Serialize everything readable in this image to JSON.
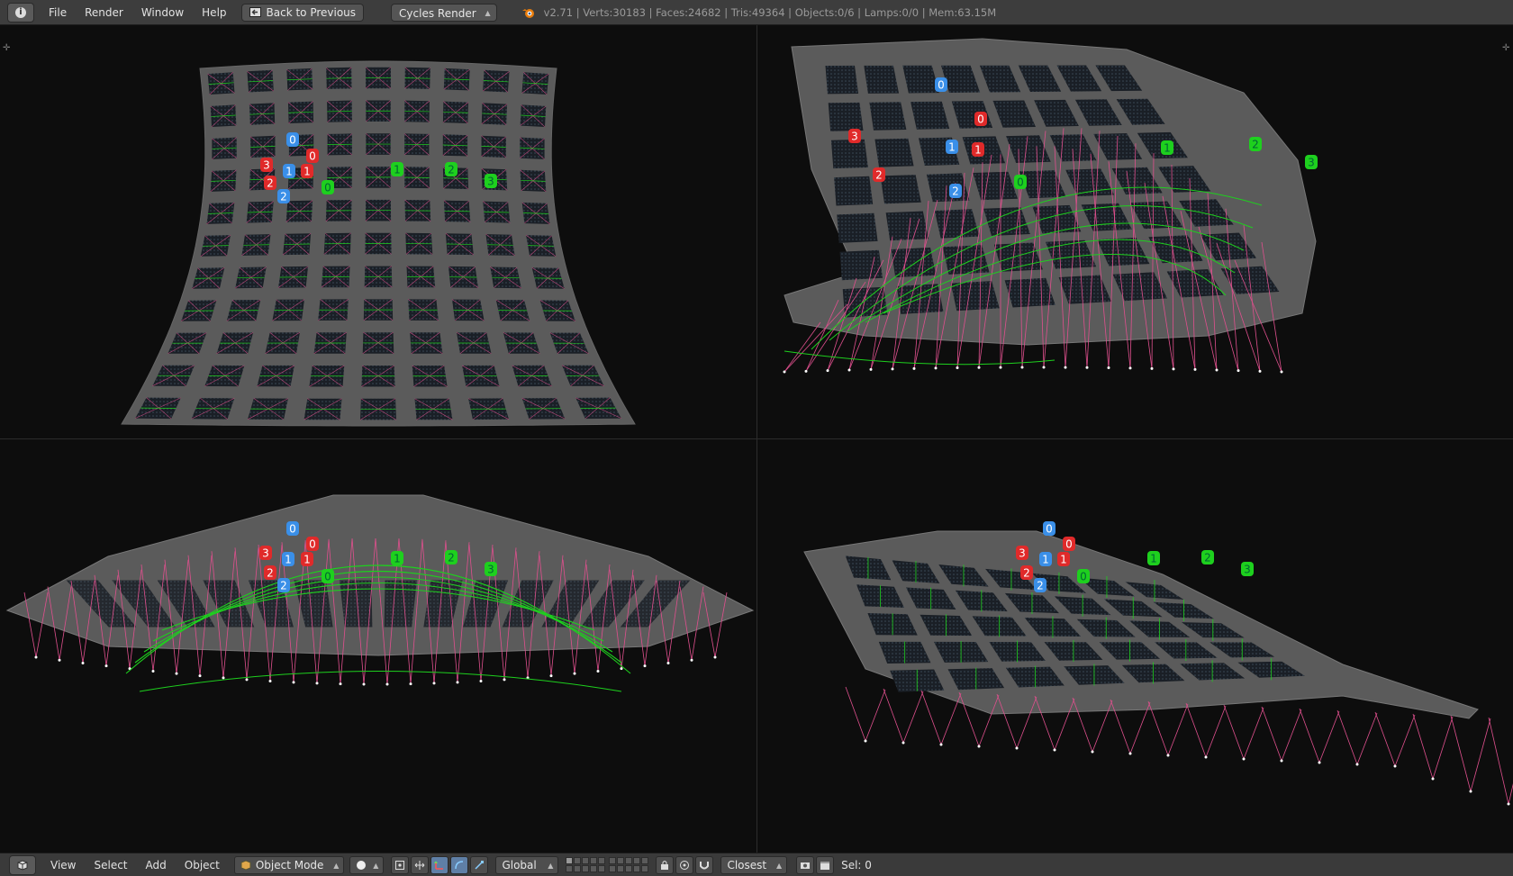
{
  "topbar": {
    "menus": [
      "File",
      "Render",
      "Window",
      "Help"
    ],
    "back_button": "Back to Previous",
    "render_engine": "Cycles Render",
    "stats": "v2.71 | Verts:30183 | Faces:24682 | Tris:49364 | Objects:0/6 | Lamps:0/0 | Mem:63.15M"
  },
  "bottombar": {
    "menus": [
      "View",
      "Select",
      "Add",
      "Object"
    ],
    "mode": "Object Mode",
    "orientation": "Global",
    "snap": "Closest",
    "selection": "Sel: 0"
  },
  "colors": {
    "blue": "#3a8fe8",
    "red": "#e02a2a",
    "green": "#1ed01e",
    "pink": "#e0508e",
    "mesh": "#5b5b5b"
  },
  "viewports": [
    {
      "id": "top",
      "labels": [
        {
          "t": "0",
          "c": "blue"
        },
        {
          "t": "1",
          "c": "blue"
        },
        {
          "t": "2",
          "c": "blue"
        },
        {
          "t": "3",
          "c": "red"
        },
        {
          "t": "0",
          "c": "red"
        },
        {
          "t": "1",
          "c": "red"
        },
        {
          "t": "2",
          "c": "red"
        },
        {
          "t": "0",
          "c": "green"
        },
        {
          "t": "1",
          "c": "green"
        },
        {
          "t": "2",
          "c": "green"
        },
        {
          "t": "3",
          "c": "green"
        }
      ]
    },
    {
      "id": "perspective",
      "labels": [
        {
          "t": "0",
          "c": "blue"
        },
        {
          "t": "1",
          "c": "blue"
        },
        {
          "t": "2",
          "c": "blue"
        },
        {
          "t": "0",
          "c": "red"
        },
        {
          "t": "1",
          "c": "red"
        },
        {
          "t": "3",
          "c": "red"
        },
        {
          "t": "2",
          "c": "red"
        },
        {
          "t": "0",
          "c": "green"
        },
        {
          "t": "1",
          "c": "green"
        },
        {
          "t": "2",
          "c": "green"
        },
        {
          "t": "3",
          "c": "green"
        }
      ]
    },
    {
      "id": "front",
      "labels": [
        {
          "t": "0",
          "c": "blue"
        },
        {
          "t": "1",
          "c": "blue"
        },
        {
          "t": "2",
          "c": "blue"
        },
        {
          "t": "3",
          "c": "red"
        },
        {
          "t": "0",
          "c": "red"
        },
        {
          "t": "1",
          "c": "red"
        },
        {
          "t": "2",
          "c": "red"
        },
        {
          "t": "0",
          "c": "green"
        },
        {
          "t": "1",
          "c": "green"
        },
        {
          "t": "2",
          "c": "green"
        },
        {
          "t": "3",
          "c": "green"
        }
      ]
    },
    {
      "id": "side",
      "labels": [
        {
          "t": "0",
          "c": "blue"
        },
        {
          "t": "1",
          "c": "blue"
        },
        {
          "t": "2",
          "c": "blue"
        },
        {
          "t": "3",
          "c": "red"
        },
        {
          "t": "0",
          "c": "red"
        },
        {
          "t": "1",
          "c": "red"
        },
        {
          "t": "2",
          "c": "red"
        },
        {
          "t": "0",
          "c": "green"
        },
        {
          "t": "1",
          "c": "green"
        },
        {
          "t": "2",
          "c": "green"
        },
        {
          "t": "3",
          "c": "green"
        }
      ]
    }
  ]
}
